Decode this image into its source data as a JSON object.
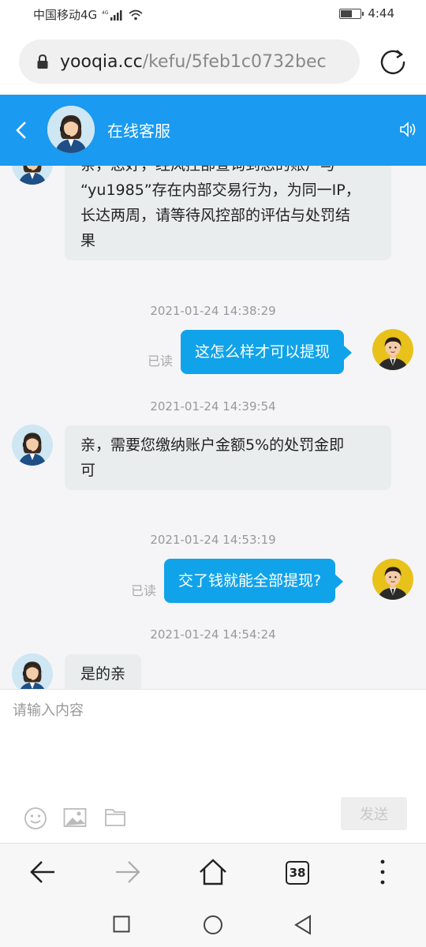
{
  "status_bar": {
    "carrier": "中国移动4G",
    "network_badge": "4G",
    "time": "4:44",
    "battery_level": 0.6
  },
  "browser": {
    "url_host": "yooqia.cc",
    "url_path": "/kefu/5feb1c0732bec",
    "tab_count": "38"
  },
  "header": {
    "title": "在线客服"
  },
  "messages": [
    {
      "direction": "incoming",
      "lines": [
        "亲，您好，经风控部查询到您的账户与",
        "“yu1985”存在内部交易行为，为同一IP，",
        "长达两周，请等待风控部的评估与处罚结",
        "果"
      ]
    },
    {
      "direction": "outgoing",
      "timestamp": "2021-01-24 14:38:29",
      "status": "已读",
      "text": "这怎么样才可以提现"
    },
    {
      "direction": "incoming",
      "timestamp": "2021-01-24 14:39:54",
      "lines": [
        "亲，需要您缴纳账户金额5%的处罚金即",
        "可"
      ]
    },
    {
      "direction": "outgoing",
      "timestamp": "2021-01-24 14:53:19",
      "status": "已读",
      "text": "交了钱就能全部提现?"
    },
    {
      "direction": "incoming",
      "timestamp": "2021-01-24 14:54:24",
      "lines": [
        "是的亲"
      ]
    }
  ],
  "composer": {
    "placeholder": "请输入内容",
    "send_label": "发送"
  },
  "icons": {
    "emoji": "emoji-icon",
    "image": "image-icon",
    "folder": "folder-icon"
  },
  "colors": {
    "header_blue": "#1a9af0",
    "outgoing_bubble": "#11a3ea",
    "incoming_bubble": "#e9edee",
    "chat_background": "#f5f5f7"
  }
}
